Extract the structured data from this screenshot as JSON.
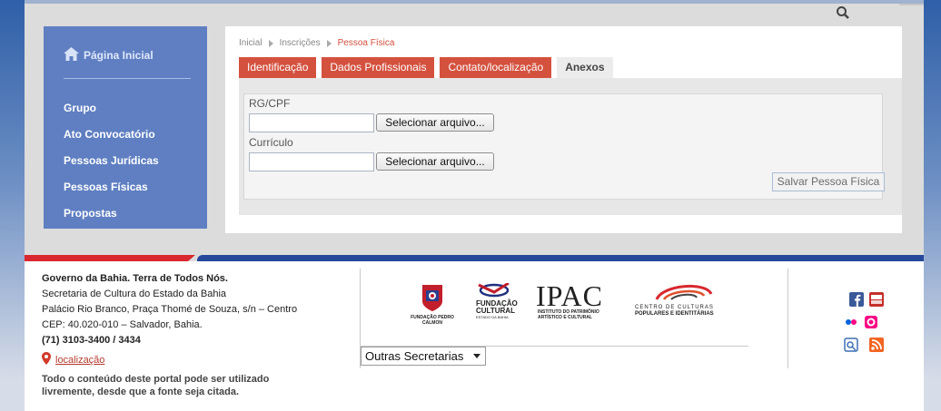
{
  "sidebar": {
    "home_label": "Página Inicial",
    "items": [
      {
        "label": "Grupo"
      },
      {
        "label": "Ato Convocatório"
      },
      {
        "label": "Pessoas Jurídicas"
      },
      {
        "label": "Pessoas Físicas"
      },
      {
        "label": "Propostas"
      }
    ]
  },
  "breadcrumb": {
    "items": [
      "Inicial",
      "Inscrições"
    ],
    "current": "Pessoa Física"
  },
  "tabs": [
    {
      "label": "Identificação",
      "active": false
    },
    {
      "label": "Dados Profissionais",
      "active": false
    },
    {
      "label": "Contato/localização",
      "active": false
    },
    {
      "label": "Anexos",
      "active": true
    }
  ],
  "form": {
    "fields": [
      {
        "label": "RG/CPF",
        "value": "",
        "button": "Selecionar arquivo..."
      },
      {
        "label": "Currículo",
        "value": "",
        "button": "Selecionar arquivo..."
      }
    ],
    "save_label": "Salvar Pessoa Física"
  },
  "footer": {
    "line1": "Governo da Bahia. Terra de Todos Nós.",
    "line2": "Secretaria de Cultura do Estado da Bahia",
    "line3": "Palácio Rio Branco, Praça Thomé de Souza, s/n – Centro",
    "line4": "CEP: 40.020-010 – Salvador, Bahia.",
    "phone": "(71) 3103-3400 / 3434",
    "location_link": "localização",
    "note": "Todo o conteúdo deste portal pode ser utilizado livremente, desde que a fonte seja citada.",
    "logos": {
      "fpc": "FUNDAÇÃO PEDRO CALMON",
      "funceb_1": "FUNDAÇÃO",
      "funceb_2": "CULTURAL",
      "funceb_3": "ESTADO DA BAHIA",
      "ipac": "IPAC",
      "ipac_sub_1": "INSTITUTO DO PATRIMÔNIO",
      "ipac_sub_2": "ARTÍSTICO E CULTURAL",
      "ccpi_1": "CENTRO DE CULTURAS",
      "ccpi_2": "POPULARES E IDENTITÁRIAS"
    },
    "secretarias_select": "Outras Secretarias",
    "social_icons": [
      "facebook-icon",
      "youtube-icon",
      "flickr-icon",
      "flickr-alt-icon",
      "delicious-icon",
      "rss-icon"
    ]
  },
  "colors": {
    "sidebar_bg": "#5f7fc2",
    "tab_bg": "#d4513e",
    "footer_red": "#d9282f",
    "footer_blue": "#26479a"
  }
}
